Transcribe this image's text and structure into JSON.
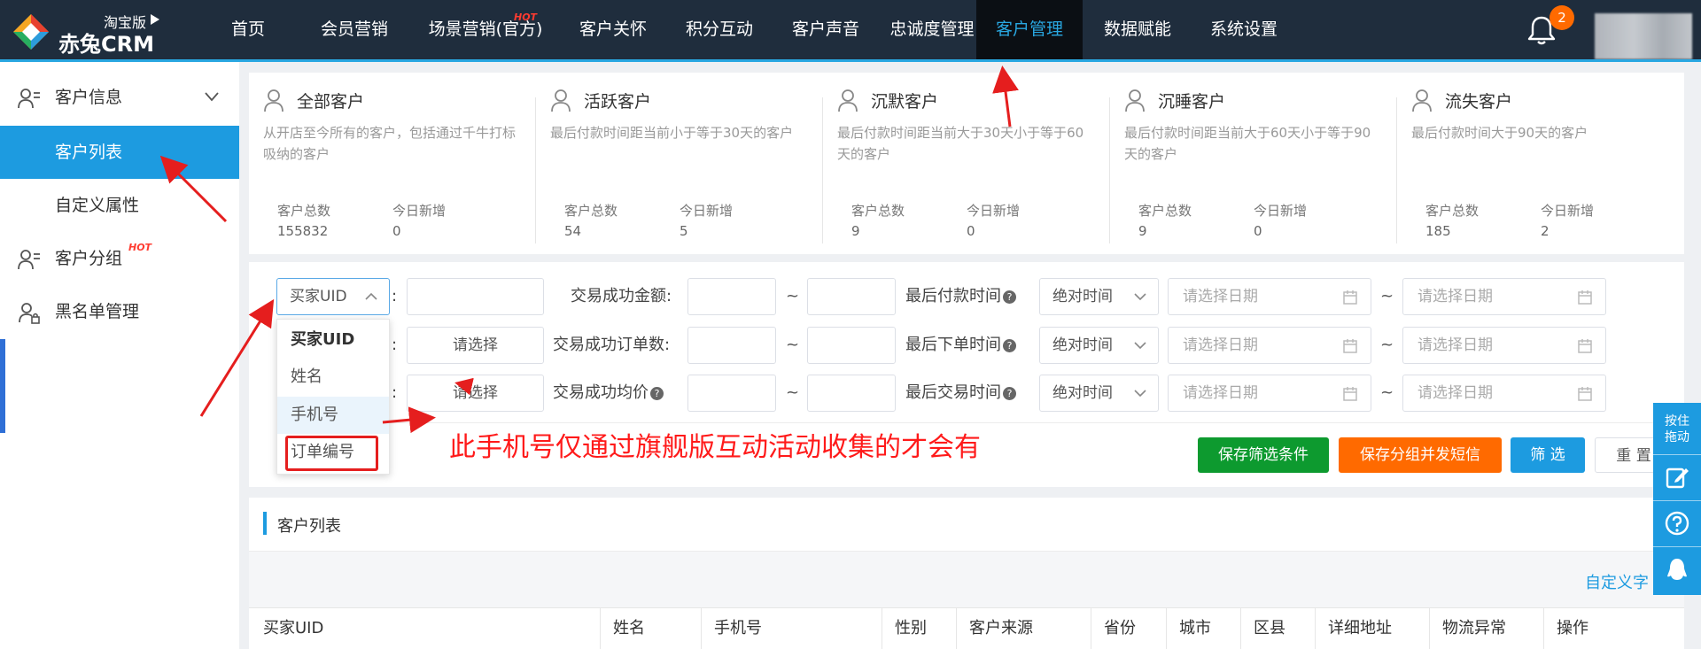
{
  "topbar": {
    "logo_edition": "淘宝版",
    "logo_name": "赤兔CRM",
    "nav": [
      {
        "label": "首页"
      },
      {
        "label": "会员营销"
      },
      {
        "label": "场景营销(官方)",
        "hot": "HOT"
      },
      {
        "label": "客户关怀"
      },
      {
        "label": "积分互动"
      },
      {
        "label": "客户声音"
      },
      {
        "label": "忠诚度管理"
      },
      {
        "label": "客户管理",
        "active": true
      },
      {
        "label": "数据赋能"
      },
      {
        "label": "系统设置"
      }
    ],
    "notification_count": "2"
  },
  "sidebar": {
    "groups": [
      {
        "label": "客户信息",
        "icon": "user-list-icon",
        "expanded": true
      },
      {
        "label": "客户列表",
        "active": true
      },
      {
        "label": "自定义属性"
      },
      {
        "label": "客户分组",
        "icon": "user-group-icon",
        "hot": "HOT"
      },
      {
        "label": "黑名单管理",
        "icon": "user-lock-icon"
      }
    ]
  },
  "cards": [
    {
      "title": "全部客户",
      "desc": "从开店至今所有的客户，包括通过千牛打标吸纳的客户",
      "total_label": "客户总数",
      "total": "155832",
      "new_label": "今日新增",
      "new": "0"
    },
    {
      "title": "活跃客户",
      "desc": "最后付款时间距当前小于等于30天的客户",
      "total_label": "客户总数",
      "total": "54",
      "new_label": "今日新增",
      "new": "5"
    },
    {
      "title": "沉默客户",
      "desc": "最后付款时间距当前大于30天小于等于60天的客户",
      "total_label": "客户总数",
      "total": "9",
      "new_label": "今日新增",
      "new": "0"
    },
    {
      "title": "沉睡客户",
      "desc": "最后付款时间距当前大于60天小于等于90天的客户",
      "total_label": "客户总数",
      "total": "9",
      "new_label": "今日新增",
      "new": "0"
    },
    {
      "title": "流失客户",
      "desc": "最后付款时间大于90天的客户",
      "total_label": "客户总数",
      "total": "185",
      "new_label": "今日新增",
      "new": "2"
    }
  ],
  "filters": {
    "uid_select": "买家UID",
    "colon": ":",
    "please_select": "请选择",
    "tilde": "~",
    "left_labels": [
      "交易成功金额:",
      "交易成功订单数:",
      "交易成功均价"
    ],
    "right_labels": [
      "最后付款时间",
      "最后下单时间",
      "最后交易时间"
    ],
    "time_mode": "绝对时间",
    "date_placeholder": "请选择日期",
    "qmark": "?",
    "dropdown": [
      "买家UID",
      "姓名",
      "手机号",
      "订单编号"
    ],
    "buttons": {
      "save_filter": "保存筛选条件",
      "save_group_sms": "保存分组并发短信",
      "filter": "筛 选",
      "reset": "重 置"
    },
    "annotation": "此手机号仅通过旗舰版互动活动收集的才会有"
  },
  "list": {
    "title": "客户列表",
    "custom_fields": "自定义字",
    "columns": [
      "买家UID",
      "姓名",
      "手机号",
      "性别",
      "客户来源",
      "省份",
      "城市",
      "区县",
      "详细地址",
      "物流异常",
      "操作"
    ]
  },
  "float_bar": {
    "drag_label": "按住\n拖动"
  },
  "colors": {
    "nav_bg": "#1f2d3d",
    "accent": "#1d9be0",
    "green": "#0d9a2f",
    "orange": "#ff6a00",
    "annotation_red": "#ff1a1a"
  }
}
